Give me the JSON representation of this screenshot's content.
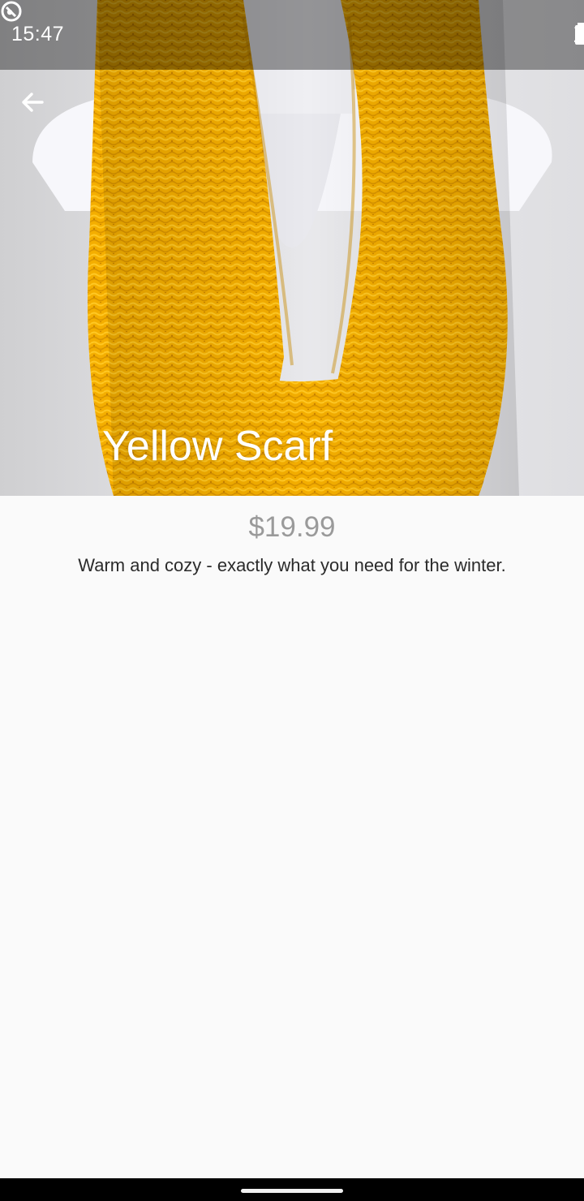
{
  "status_bar": {
    "time": "15:47",
    "app_icon": "app-notification-icon",
    "wifi_icon": "wifi-icon",
    "signal_icon": "cell-signal-icon",
    "battery_icon": "battery-icon"
  },
  "header": {
    "back_icon": "arrow-back-icon"
  },
  "product": {
    "title": "Yellow Scarf",
    "price": "$19.99",
    "description": "Warm and cozy - exactly what you need for the winter.",
    "image_subject": "yellow knit infinity scarf on white mannequin"
  },
  "colors": {
    "background": "#fafafa",
    "scarf": "#f6b400",
    "price_text": "#9a9a9a",
    "description_text": "#2b2b2b"
  }
}
